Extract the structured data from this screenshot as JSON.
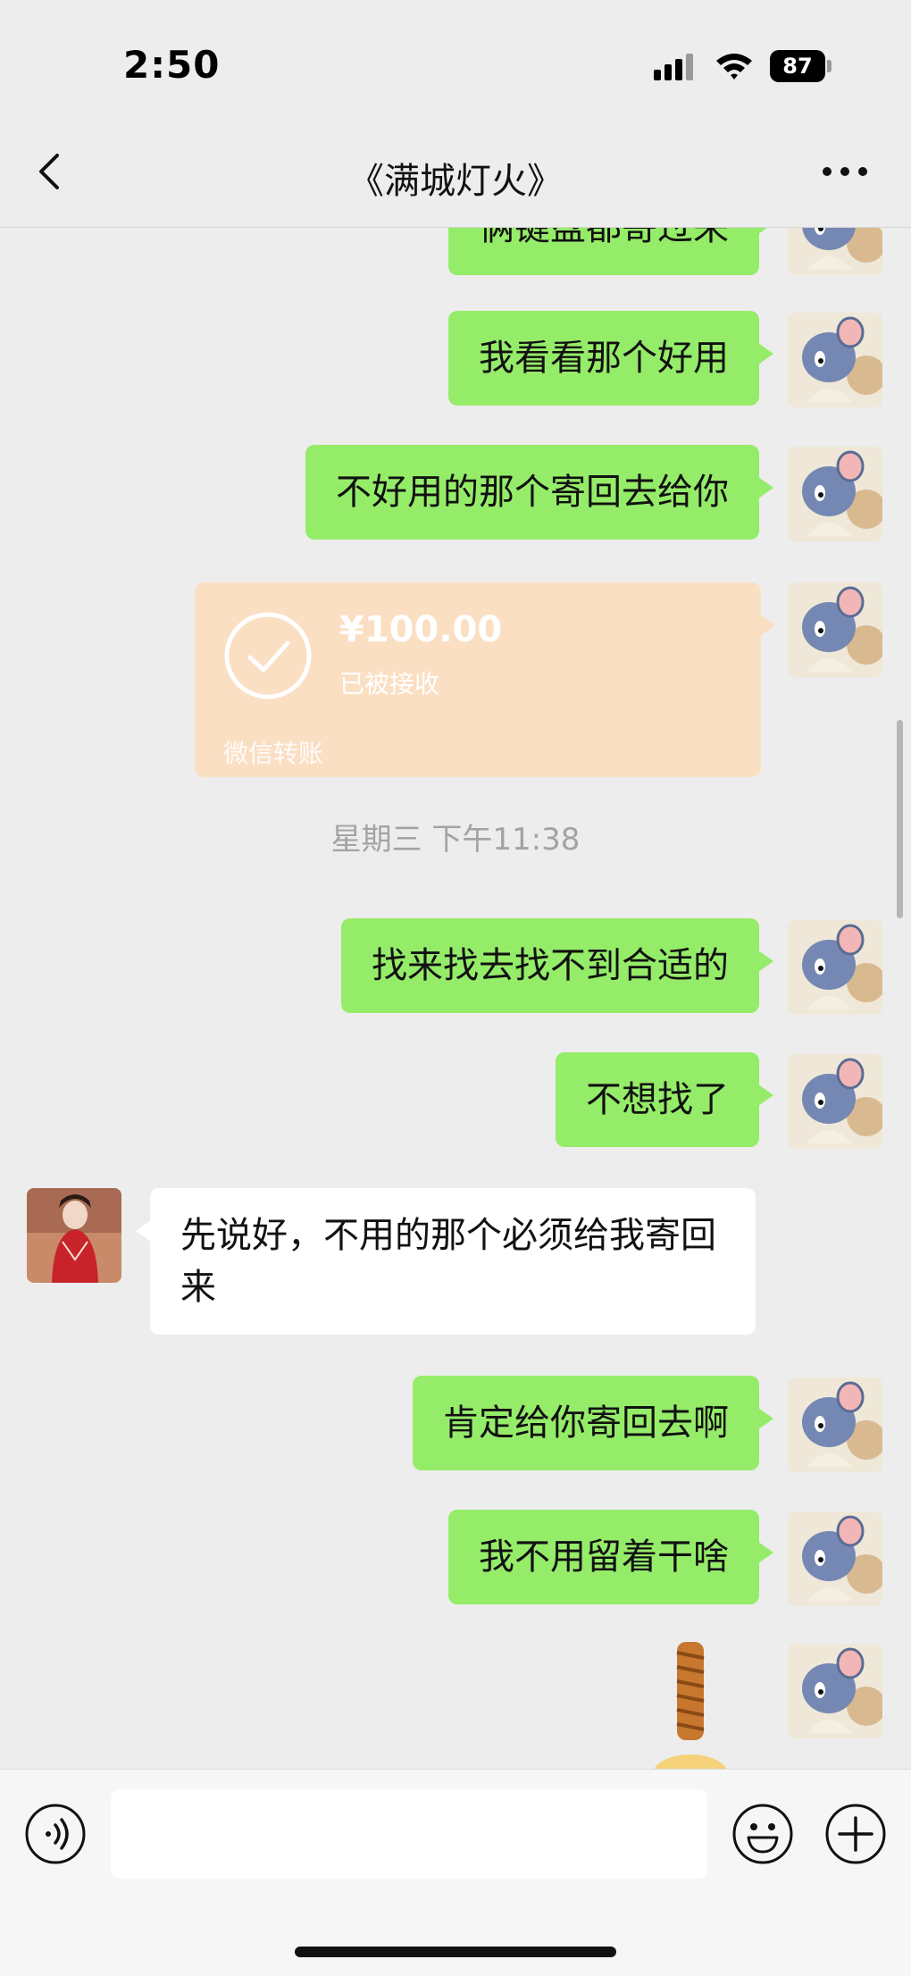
{
  "status": {
    "time": "2:50",
    "battery": "87"
  },
  "nav": {
    "title": "《满城灯火》"
  },
  "messages": [
    {
      "text": "俩键盘都寄过来"
    },
    {
      "text": "我看看那个好用"
    },
    {
      "text": "不好用的那个寄回去给你"
    },
    {
      "text": "找来找去找不到合适的"
    },
    {
      "text": "不想找了"
    },
    {
      "text": "先说好，不用的那个必须给我寄回来"
    },
    {
      "text": "肯定给你寄回去啊"
    },
    {
      "text": "我不用留着干啥"
    }
  ],
  "transfer": {
    "amount": "¥100.00",
    "status": "已被接收",
    "footer": "微信转账"
  },
  "timestamp": "星期三 下午11:38",
  "input": {
    "placeholder": ""
  },
  "icons": {
    "back": "chevron-left-icon",
    "more": "more-dots-icon",
    "voice": "voice-icon",
    "emoji": "emoji-icon",
    "plus": "plus-icon",
    "check": "check-icon"
  },
  "colors": {
    "self_bubble": "#95ec69",
    "other_bubble": "#ffffff",
    "transfer_received": "#fbdfc3",
    "background": "#ededed"
  }
}
